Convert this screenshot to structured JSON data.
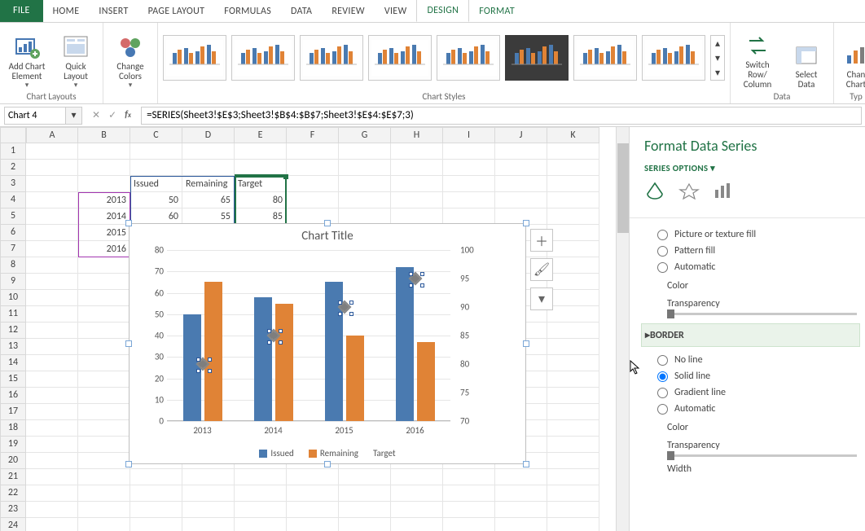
{
  "tabs": {
    "file": "FILE",
    "home": "HOME",
    "insert": "INSERT",
    "page_layout": "PAGE LAYOUT",
    "formulas": "FORMULAS",
    "data": "DATA",
    "review": "REVIEW",
    "view": "VIEW",
    "design": "DESIGN",
    "format": "FORMAT"
  },
  "ribbon": {
    "chart_layouts": {
      "label": "Chart Layouts",
      "add_element": "Add Chart\nElement",
      "quick_layout": "Quick\nLayout"
    },
    "change_colors": "Change\nColors",
    "chart_styles": "Chart Styles",
    "data_group": {
      "label": "Data",
      "switch": "Switch Row/\nColumn",
      "select": "Select\nData"
    },
    "type_group": {
      "label": "Typ",
      "change": "Chan\nChart"
    }
  },
  "namebox": "Chart 4",
  "formula": "=SERIES(Sheet3!$E$3;Sheet3!$B$4:$B$7;Sheet3!$E$4:$E$7;3)",
  "columns": [
    "A",
    "B",
    "C",
    "D",
    "E",
    "F",
    "G",
    "H",
    "I",
    "J",
    "K"
  ],
  "cells": {
    "C3": "Issued",
    "D3": "Remaining",
    "E3": "Target",
    "B4": "2013",
    "C4": "50",
    "D4": "65",
    "E4": "80",
    "B5": "2014",
    "C5": "60",
    "D5": "55",
    "E5": "85",
    "B6": "2015",
    "B7": "2016"
  },
  "chart_data": {
    "type": "bar",
    "title": "Chart Title",
    "categories": [
      "2013",
      "2014",
      "2015",
      "2016"
    ],
    "series": [
      {
        "name": "Issued",
        "color": "#4a7ab0",
        "values": [
          50,
          58,
          65,
          72
        ]
      },
      {
        "name": "Remaining",
        "color": "#e08336",
        "values": [
          65,
          55,
          40,
          37
        ]
      },
      {
        "name": "Target",
        "color": "#7e7e7e",
        "axis": "secondary",
        "type": "scatter",
        "values": [
          80,
          85,
          90,
          95
        ]
      }
    ],
    "y": {
      "min": 0,
      "max": 80,
      "ticks": [
        0,
        10,
        20,
        30,
        40,
        50,
        60,
        70,
        80
      ]
    },
    "y2": {
      "min": 70,
      "max": 100,
      "ticks": [
        70,
        75,
        80,
        85,
        90,
        95,
        100
      ]
    },
    "legend": [
      "Issued",
      "Remaining",
      "Target"
    ]
  },
  "pane": {
    "title": "Format Data Series",
    "series_options": "SERIES OPTIONS",
    "fill": {
      "picture": "Picture or texture fill",
      "pattern": "Pattern fill",
      "automatic": "Automatic",
      "color": "Color",
      "transparency": "Transparency"
    },
    "border": {
      "header": "BORDER",
      "no_line": "No line",
      "solid": "Solid line",
      "gradient": "Gradient line",
      "automatic": "Automatic",
      "color": "Color",
      "transparency": "Transparency",
      "width": "Width"
    }
  }
}
